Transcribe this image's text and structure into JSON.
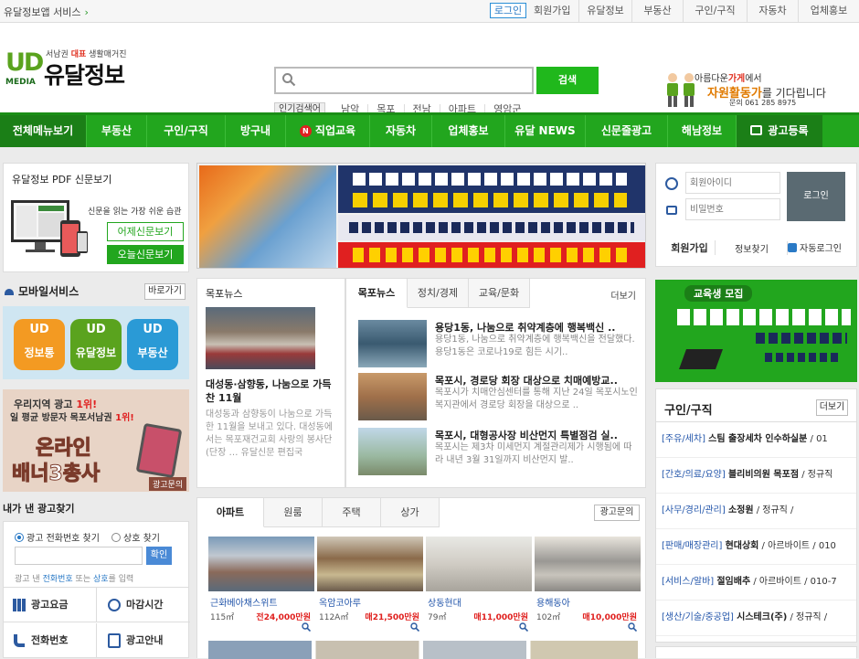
{
  "topbar": {
    "service_label": "유달정보앱 서비스",
    "links": [
      "로그인",
      "회원가입",
      "유달정보",
      "부동산",
      "구인/구직",
      "자동차",
      "업체홍보"
    ]
  },
  "logo": {
    "mark": "UD",
    "media": "MEDIA",
    "tagline_pre": "서남권 ",
    "tagline_hl": "대표",
    "tagline_post": " 생활매거진",
    "name": "유달정보"
  },
  "search": {
    "placeholder": "",
    "button": "검색",
    "popular_label": "인기검색어",
    "keywords": [
      "남악",
      "목포",
      "전남",
      "아파트",
      "영암군"
    ]
  },
  "volunteer": {
    "line1_pre": "아름다운",
    "line1_hl": "가게",
    "line1_post": "에서",
    "line2_hl": "자원활동가",
    "line2_post": "를 기다립니다",
    "line3": "문의 061 285 8975"
  },
  "nav": [
    "전체메뉴보기",
    "부동산",
    "구인/구직",
    "방구내",
    "직업교육",
    "자동차",
    "업체홍보",
    "유달 NEWS",
    "신문줄광고",
    "해남정보",
    "광고등록"
  ],
  "nav_badge": "N",
  "pdf": {
    "title": "유달정보 PDF 신문보기",
    "desc": "신문을 읽는 가장 쉬운 습관",
    "yesterday": "어제신문보기",
    "today": "오늘신문보기"
  },
  "mobile": {
    "title": "모바일서비스",
    "shortcut": "바로가기",
    "apps": [
      "정보통",
      "유달정보",
      "부동산"
    ],
    "app_mark": "UD"
  },
  "banner3": {
    "line1_pre": "우리지역 광고",
    "line1_hl": "1위!",
    "line2_pre": "일 평균 방문자 목포서남권",
    "line2_hl": "1위!",
    "line3": "온라인",
    "line4": "배너3총사",
    "line5": "광고문의"
  },
  "myad": {
    "title": "내가 낸 광고찾기",
    "radio1": "광고 전화번호 찾기",
    "radio2": "상호 찾기",
    "confirm": "확인",
    "hint_pre": "광고 낸 ",
    "hint_phone": "전화번호",
    "hint_mid": " 또는 ",
    "hint_name": "상호",
    "hint_post": "를 입력",
    "menu": [
      "광고요금",
      "마감시간",
      "전화번호",
      "광고안내"
    ]
  },
  "mokpo_news": {
    "title": "목포뉴스",
    "headline": "대성동·삼향동, 나눔으로 가득 찬 11월",
    "summary": "대성동과 삼향동이 나눔으로 가득한 11월을 보내고 있다. 대성동에서는 목포재건교회 사랑의 봉사단(단장 … 유달신문 편집국"
  },
  "news_tabs": {
    "tabs": [
      "목포뉴스",
      "정치/경제",
      "교육/문화"
    ],
    "more": "더보기"
  },
  "news_list": [
    {
      "title": "용당1동, 나눔으로 취약계층에 행복백신 ..",
      "summary": "용당1동, 나눔으로 취약계층에 행복백신을 전달했다. 용당1동은 코로나19로 힘든 시기.."
    },
    {
      "title": "목포시, 경로당 회장 대상으로 치매예방교..",
      "summary": "목포시가 치매안심센터를 통해 지난 24일 목포시노인복지관에서 경로당 회장을 대상으로 .."
    },
    {
      "title": "목포시, 대형공사장 비산먼지 특별점검 실..",
      "summary": "목포시는 제3차 미세먼지 계절관리제가 시행됨에 따라 내년 3월 31일까지 비산먼지 발.."
    }
  ],
  "realestate": {
    "tabs": [
      "아파트",
      "원룸",
      "주택",
      "상가"
    ],
    "ad_inquiry": "광고문의",
    "items": [
      {
        "name": "근화베아채스위트",
        "area": "115㎡",
        "price": "전24,000만원"
      },
      {
        "name": "옥암코아루",
        "area": "112A㎡",
        "price": "매21,500만원"
      },
      {
        "name": "상동현대",
        "area": "79㎡",
        "price": "매11,000만원"
      },
      {
        "name": "용해동아",
        "area": "102㎡",
        "price": "매10,000만원"
      }
    ]
  },
  "login": {
    "id_placeholder": "회원아이디",
    "pw_placeholder": "비밀번호",
    "login": "로그인",
    "join": "회원가입",
    "find": "정보찾기",
    "auto": "자동로그인"
  },
  "edu_banner": {
    "title": "교육생 모집"
  },
  "jobs": {
    "title": "구인/구직",
    "more": "더보기",
    "items": [
      {
        "cat": "[주유/세차]",
        "co": "스팀 출장세차 인수하실분",
        "rest": " / 01"
      },
      {
        "cat": "[간호/의료/요양]",
        "co": "블리비의원 목포점",
        "rest": " / 정규직"
      },
      {
        "cat": "[사무/경리/관리]",
        "co": "소정원",
        "rest": " / 정규직 /"
      },
      {
        "cat": "[판매/매장관리]",
        "co": "현대상회",
        "rest": " / 아르바이트 / 010"
      },
      {
        "cat": "[서비스/알바]",
        "co": "절임배추",
        "rest": " / 아르바이트 / 010-7"
      },
      {
        "cat": "[생산/기술/중공업]",
        "co": "시스테크(주)",
        "rest": " / 정규직 /"
      }
    ]
  },
  "colors": {
    "brand_green": "#22a61e",
    "dark_green": "#1b7f17",
    "link_blue": "#2255aa",
    "price_red": "#e0201e"
  }
}
